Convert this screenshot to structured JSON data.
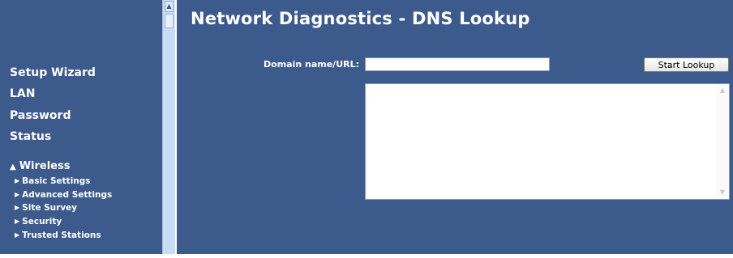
{
  "sidebar": {
    "items": [
      {
        "label": "Setup Wizard"
      },
      {
        "label": "LAN"
      },
      {
        "label": "Password"
      },
      {
        "label": "Status"
      }
    ],
    "wireless": {
      "label": "Wireless",
      "expanded_icon": "triangle-up-icon",
      "subitems": [
        {
          "label": "Basic Settings"
        },
        {
          "label": "Advanced Settings"
        },
        {
          "label": "Site Survey"
        },
        {
          "label": "Security"
        },
        {
          "label": "Trusted Stations"
        }
      ]
    }
  },
  "main": {
    "title": "Network Diagnostics - DNS Lookup",
    "domain_label": "Domain name/URL:",
    "domain_value": "",
    "start_button": "Start Lookup",
    "result_text": ""
  },
  "colors": {
    "background": "#3c5a8c",
    "text": "#ffffff",
    "scrollbar": "#c9dcf5"
  }
}
